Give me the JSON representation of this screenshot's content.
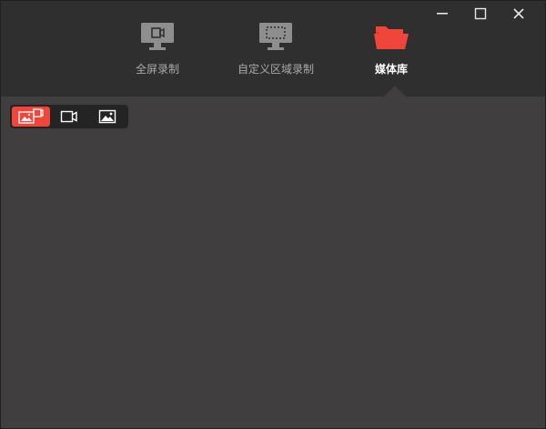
{
  "window": {
    "controls": [
      "minimize",
      "maximize",
      "close"
    ]
  },
  "tabs": [
    {
      "label": "全屏录制",
      "icon": "fullscreen-record-icon",
      "active": false
    },
    {
      "label": "自定义区域录制",
      "icon": "region-record-icon",
      "active": false
    },
    {
      "label": "媒体库",
      "icon": "folder-icon",
      "active": true
    }
  ],
  "filters": [
    {
      "name": "all-media",
      "icon": "all-media-icon",
      "active": true
    },
    {
      "name": "video",
      "icon": "video-icon",
      "active": false
    },
    {
      "name": "image",
      "icon": "image-icon",
      "active": false
    }
  ],
  "colors": {
    "accent": "#f0453a",
    "header_bg": "#2f2f2f",
    "body_bg": "#403e3f"
  }
}
